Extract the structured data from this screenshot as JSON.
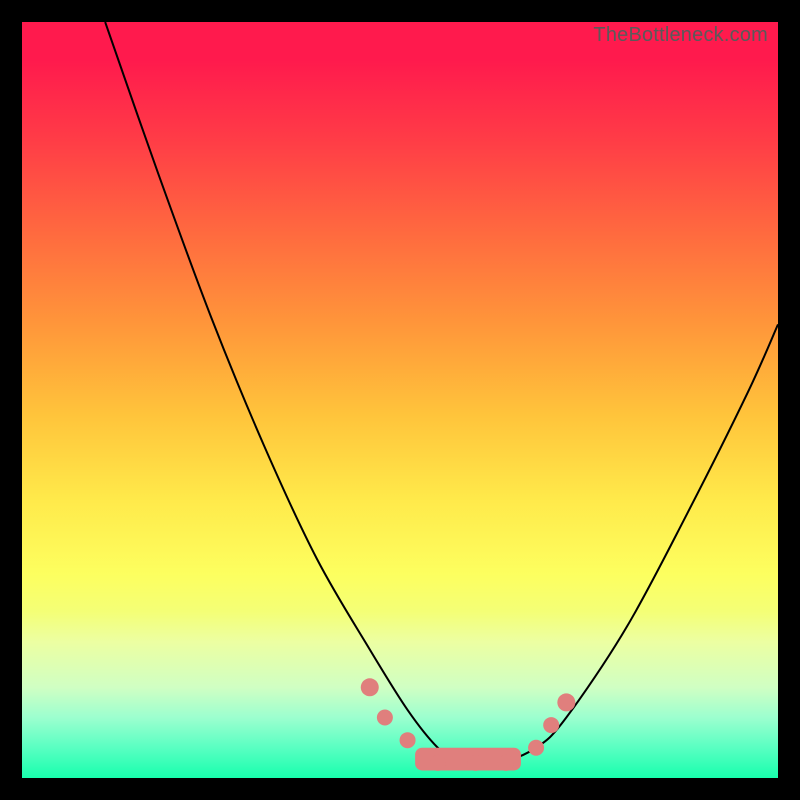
{
  "watermark": "TheBottleneck.com",
  "colors": {
    "marker": "#e07f7d",
    "curve": "#000000",
    "frame_bg_top": "#ff1a4d",
    "frame_bg_bottom": "#18ffad"
  },
  "chart_data": {
    "type": "line",
    "title": "",
    "xlabel": "",
    "ylabel": "",
    "xlim": [
      0,
      100
    ],
    "ylim": [
      0,
      100
    ],
    "series": [
      {
        "name": "bottleneck-curve",
        "x": [
          11,
          18,
          25,
          32,
          39,
          46,
          51,
          55,
          58,
          63,
          68,
          72,
          80,
          88,
          96,
          100
        ],
        "y": [
          100,
          80,
          61,
          44,
          29,
          17,
          9,
          4,
          2,
          2,
          4,
          8,
          20,
          35,
          51,
          60
        ]
      }
    ],
    "markers": [
      {
        "x": 46,
        "y": 12,
        "r": 9
      },
      {
        "x": 48,
        "y": 8,
        "r": 8
      },
      {
        "x": 51,
        "y": 5,
        "r": 8
      },
      {
        "x": 55,
        "y": 2,
        "r": 8
      },
      {
        "x": 60,
        "y": 2,
        "r": 8
      },
      {
        "x": 64,
        "y": 2,
        "r": 8
      },
      {
        "x": 68,
        "y": 4,
        "r": 8
      },
      {
        "x": 70,
        "y": 7,
        "r": 8
      },
      {
        "x": 72,
        "y": 10,
        "r": 9
      }
    ],
    "flat_bar": {
      "x0": 52,
      "x1": 66,
      "y": 1,
      "h": 3
    }
  }
}
